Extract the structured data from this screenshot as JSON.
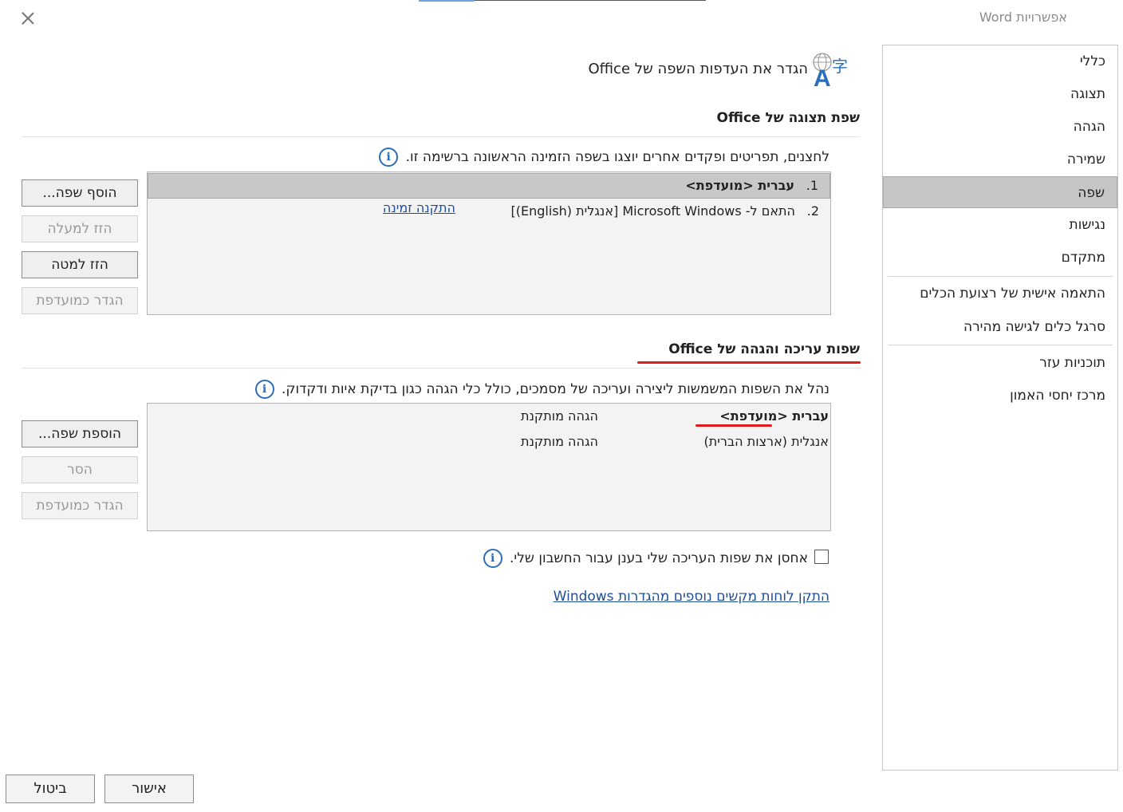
{
  "window": {
    "title": "אפשרויות Word"
  },
  "sidebar": {
    "items": [
      {
        "label": "כללי"
      },
      {
        "label": "תצוגה"
      },
      {
        "label": "הגהה"
      },
      {
        "label": "שמירה"
      },
      {
        "label": "שפה"
      },
      {
        "label": "נגישות"
      },
      {
        "label": "מתקדם"
      },
      {
        "label": "התאמה אישית של רצועת הכלים"
      },
      {
        "label": "סרגל כלים לגישה מהירה"
      },
      {
        "label": "תוכניות עזר"
      },
      {
        "label": "מרכז יחסי האמון"
      }
    ],
    "active": "שפה"
  },
  "header": {
    "title": "הגדר את העדפות השפה של Office"
  },
  "display_section": {
    "title": "שפת תצוגה של Office",
    "description": "לחצנים, תפריטים ופקדים אחרים יוצגו בשפה הזמינה הראשונה ברשימה זו.",
    "rows": [
      {
        "num": "1.",
        "name": "עברית <מועדפת>",
        "status": ""
      },
      {
        "num": "2.",
        "name": "התאם ל- Microsoft Windows [אנגלית (English)]",
        "status": "התקנה זמינה"
      }
    ],
    "buttons": {
      "add": "הוסף שפה...",
      "move_up": "הזז למעלה",
      "move_down": "הזז למטה",
      "set_preferred": "הגדר כמועדפת"
    }
  },
  "editing_section": {
    "title": "שפות עריכה והגהה של Office",
    "description": "נהל את השפות המשמשות ליצירה ועריכה של מסמכים, כולל כלי הגהה כגון בדיקת איות ודקדוק.",
    "rows": [
      {
        "name": "עברית <מועדפת>",
        "status": "הגהה מותקנת"
      },
      {
        "name": "אנגלית (ארצות הברית)",
        "status": "הגהה מותקנת"
      }
    ],
    "buttons": {
      "add": "הוספת שפה...",
      "remove": "הסר",
      "set_preferred": "הגדר כמועדפת"
    }
  },
  "cloud_checkbox": {
    "label": "אחסן את שפות העריכה שלי בענן עבור החשבון שלי.",
    "checked": false
  },
  "windows_link": "התקן לוחות מקשים נוספים מהגדרות Windows",
  "footer": {
    "ok": "אישור",
    "cancel": "ביטול"
  },
  "colors": {
    "accent": "#2a6ebb",
    "annotation": "#e01b1b",
    "link": "#1f4e99"
  }
}
